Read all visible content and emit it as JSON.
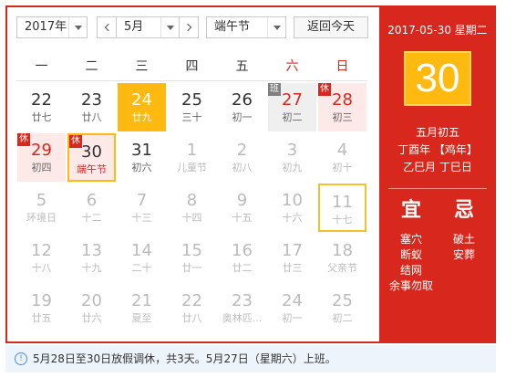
{
  "toolbar": {
    "year_value": "2017年",
    "month_value": "5月",
    "holiday_value": "端午节",
    "today_label": "返回今天"
  },
  "weekdays": [
    "一",
    "二",
    "三",
    "四",
    "五",
    "六",
    "日"
  ],
  "days": [
    {
      "d": "22",
      "l": "廿七",
      "badge": ""
    },
    {
      "d": "23",
      "l": "廿八",
      "badge": ""
    },
    {
      "d": "24",
      "l": "廿九",
      "badge": ""
    },
    {
      "d": "25",
      "l": "三十",
      "badge": ""
    },
    {
      "d": "26",
      "l": "初一",
      "badge": ""
    },
    {
      "d": "27",
      "l": "初二",
      "badge": "班"
    },
    {
      "d": "28",
      "l": "初三",
      "badge": "休"
    },
    {
      "d": "29",
      "l": "初四",
      "badge": "休"
    },
    {
      "d": "30",
      "l": "端午节",
      "badge": "休"
    },
    {
      "d": "31",
      "l": "初六",
      "badge": ""
    },
    {
      "d": "1",
      "l": "儿童节",
      "badge": ""
    },
    {
      "d": "2",
      "l": "初八",
      "badge": ""
    },
    {
      "d": "3",
      "l": "初九",
      "badge": ""
    },
    {
      "d": "4",
      "l": "初十",
      "badge": ""
    },
    {
      "d": "5",
      "l": "环境日",
      "badge": ""
    },
    {
      "d": "6",
      "l": "十二",
      "badge": ""
    },
    {
      "d": "7",
      "l": "十三",
      "badge": ""
    },
    {
      "d": "8",
      "l": "十四",
      "badge": ""
    },
    {
      "d": "9",
      "l": "十五",
      "badge": ""
    },
    {
      "d": "10",
      "l": "十六",
      "badge": ""
    },
    {
      "d": "11",
      "l": "十七",
      "badge": ""
    },
    {
      "d": "12",
      "l": "十八",
      "badge": ""
    },
    {
      "d": "13",
      "l": "十九",
      "badge": ""
    },
    {
      "d": "14",
      "l": "二十",
      "badge": ""
    },
    {
      "d": "15",
      "l": "廿一",
      "badge": ""
    },
    {
      "d": "16",
      "l": "廿二",
      "badge": ""
    },
    {
      "d": "17",
      "l": "廿三",
      "badge": ""
    },
    {
      "d": "18",
      "l": "父亲节",
      "badge": ""
    },
    {
      "d": "19",
      "l": "廿五",
      "badge": ""
    },
    {
      "d": "20",
      "l": "廿六",
      "badge": ""
    },
    {
      "d": "21",
      "l": "夏至",
      "badge": ""
    },
    {
      "d": "22",
      "l": "廿八",
      "badge": ""
    },
    {
      "d": "23",
      "l": "奥林匹...",
      "badge": ""
    },
    {
      "d": "24",
      "l": "初一",
      "badge": ""
    },
    {
      "d": "25",
      "l": "初二",
      "badge": ""
    }
  ],
  "detail": {
    "date_line": "2017-05-30 星期二",
    "big_day": "30",
    "lunar_date": "五月初五",
    "year_line": "丁酉年 【鸡年】",
    "month_day_line": "乙巳月 丁巳日",
    "yi_label": "宜",
    "ji_label": "忌",
    "yi_items": [
      "塞穴",
      "断蚁",
      "结网",
      "余事勿取"
    ],
    "ji_items": [
      "破土",
      "安葬"
    ]
  },
  "notice": {
    "text": "5月28日至30日放假调休，共3天。5月27日（星期六）上班。"
  },
  "colors": {
    "accent_red": "#d8281e",
    "today_yellow": "#ffb90f",
    "holiday_bg": "#fde9e7",
    "notice_bg": "#eef4fb"
  }
}
